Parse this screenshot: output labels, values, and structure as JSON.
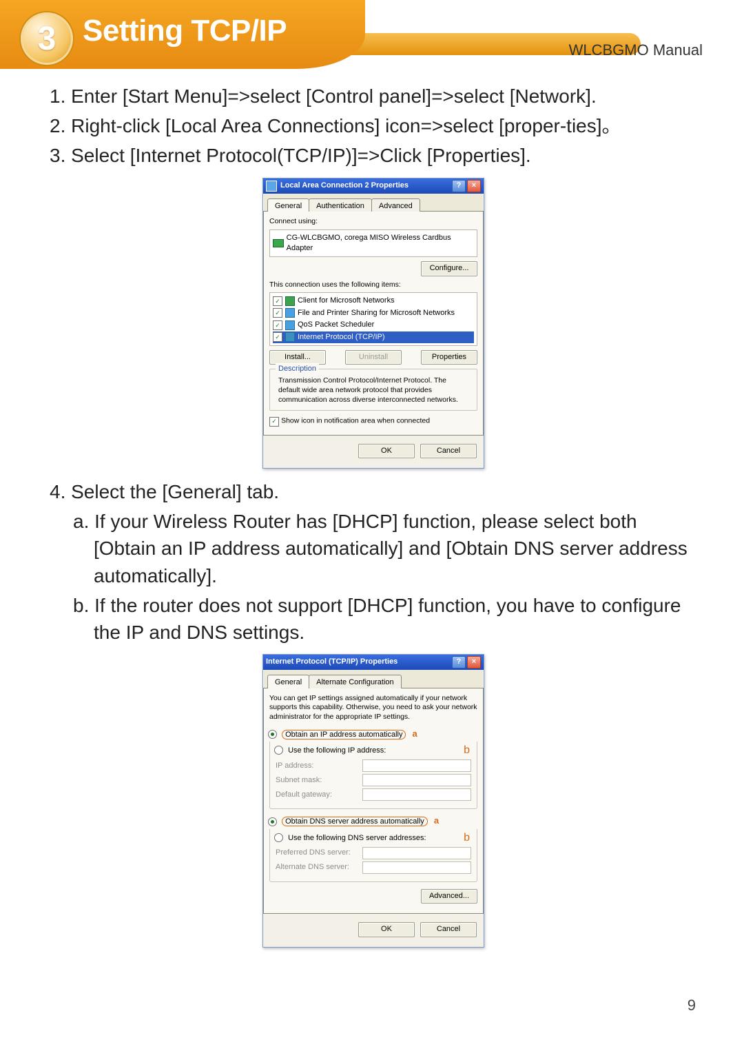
{
  "header": {
    "chapter_number": "3",
    "chapter_title": "Setting TCP/IP",
    "manual_label": "WLCBGMO  Manual"
  },
  "page_number": "9",
  "steps": {
    "s1": "1. Enter [Start Menu]=>select [Control panel]=>select [Network].",
    "s2": "2. Right-click [Local Area Connections] icon=>select [proper-ties]。",
    "s3": "3. Select [Internet Protocol(TCP/IP)]=>Click [Properties].",
    "s4": "4. Select the [General] tab.",
    "s4a": "a. If your Wireless Router has [DHCP] function, please select both [Obtain an IP address automatically] and [Obtain DNS server address automatically].",
    "s4b": "b. If the router does not support [DHCP] function, you have to configure the IP and DNS settings."
  },
  "dialog1": {
    "title": "Local Area Connection 2 Properties",
    "tabs": {
      "general": "General",
      "auth": "Authentication",
      "adv": "Advanced"
    },
    "connect_using_label": "Connect using:",
    "adapter": "CG-WLCBGMO, corega MISO Wireless Cardbus Adapter",
    "configure_btn": "Configure...",
    "items_label": "This connection uses the following items:",
    "items": {
      "i1": "Client for Microsoft Networks",
      "i2": "File and Printer Sharing for Microsoft Networks",
      "i3": "QoS Packet Scheduler",
      "i4": "Internet Protocol (TCP/IP)"
    },
    "install_btn": "Install...",
    "uninstall_btn": "Uninstall",
    "properties_btn": "Properties",
    "desc_label": "Description",
    "desc_text": "Transmission Control Protocol/Internet Protocol. The default wide area network protocol that provides communication across diverse interconnected networks.",
    "show_icon": "Show icon in notification area when connected",
    "ok": "OK",
    "cancel": "Cancel"
  },
  "dialog2": {
    "title": "Internet Protocol (TCP/IP) Properties",
    "tabs": {
      "general": "General",
      "alt": "Alternate Configuration"
    },
    "intro": "You can get IP settings assigned automatically if your network supports this capability. Otherwise, you need to ask your network administrator for the appropriate IP settings.",
    "opt_auto_ip": "Obtain an IP address automatically",
    "opt_manual_ip": "Use the following IP address:",
    "ip_label": "IP address:",
    "mask_label": "Subnet mask:",
    "gw_label": "Default gateway:",
    "opt_auto_dns": "Obtain DNS server address automatically",
    "opt_manual_dns": "Use the following DNS server addresses:",
    "pdns_label": "Preferred DNS server:",
    "adns_label": "Alternate DNS server:",
    "advanced_btn": "Advanced...",
    "ok": "OK",
    "cancel": "Cancel",
    "note_a": "a",
    "note_b": "b"
  }
}
